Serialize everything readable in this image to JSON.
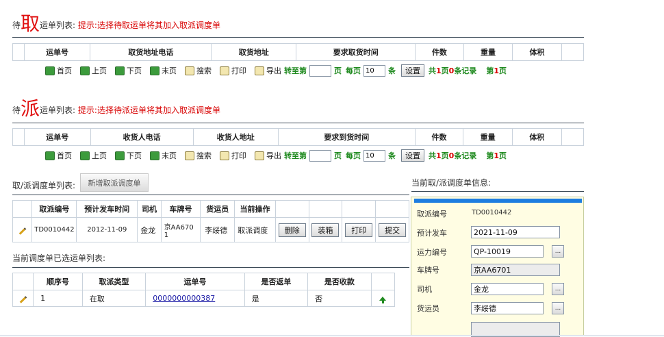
{
  "pickup": {
    "title_prefix": "待",
    "title_big": "取",
    "title_suffix": "运单列表:",
    "hint": "提示:选择待取运单将其加入取派调度单",
    "columns": [
      "运单号",
      "取货地址电话",
      "取货地址",
      "要求取货时间",
      "件数",
      "重量",
      "体积"
    ]
  },
  "delivery": {
    "title_prefix": "待",
    "title_big": "派",
    "title_suffix": "运单列表:",
    "hint": "提示:选择待派运单将其加入取派调度单",
    "columns": [
      "运单号",
      "收货人电话",
      "收货人地址",
      "要求到货时间",
      "件数",
      "重量",
      "体积"
    ]
  },
  "pager": {
    "first": "首页",
    "prev": "上页",
    "next": "下页",
    "last": "末页",
    "search": "搜索",
    "print": "打印",
    "export": "导出",
    "goto_prefix": "转至第",
    "goto_suffix": "页",
    "per_page_prefix": "每页",
    "per_page_value": "10",
    "per_page_suffix": "条",
    "set_btn": "设置",
    "summary_a": "共",
    "total_pages": "1",
    "summary_b": "页",
    "total_records": "0",
    "summary_c": "条记录",
    "current_a": "第",
    "current_page": "1",
    "current_b": "页"
  },
  "dispatch": {
    "title": "取/派调度单列表:",
    "new_btn": "新增取派调度单",
    "columns": [
      "取派编号",
      "预计发车时间",
      "司机",
      "车牌号",
      "货运员",
      "当前操作"
    ],
    "row": {
      "id": "TD0010442",
      "date": "2012-11-09",
      "driver": "金龙",
      "plate": "京AA6701",
      "staff": "李绥德",
      "op": "取派调度",
      "actions": [
        "删除",
        "装箱",
        "打印",
        "提交"
      ]
    }
  },
  "selected": {
    "title": "当前调度单已选运单列表:",
    "columns": [
      "顺序号",
      "取派类型",
      "运单号",
      "是否返单",
      "是否收款"
    ],
    "row": {
      "seq": "1",
      "type": "在取",
      "waybill": "0000000000387",
      "is_return": "是",
      "is_paid": "否"
    }
  },
  "form": {
    "title": "当前取/派调度单信息:",
    "id_label": "取派编号",
    "id_value": "TD0010442",
    "depart_label": "预计发车",
    "depart_value": "2021-11-09",
    "capacity_label": "运力编号",
    "capacity_value": "QP-10019",
    "plate_label": "车牌号",
    "plate_value": "京AA6701",
    "driver_label": "司机",
    "driver_value": "金龙",
    "staff_label": "货运员",
    "staff_value": "李绥德",
    "dots": "..."
  }
}
